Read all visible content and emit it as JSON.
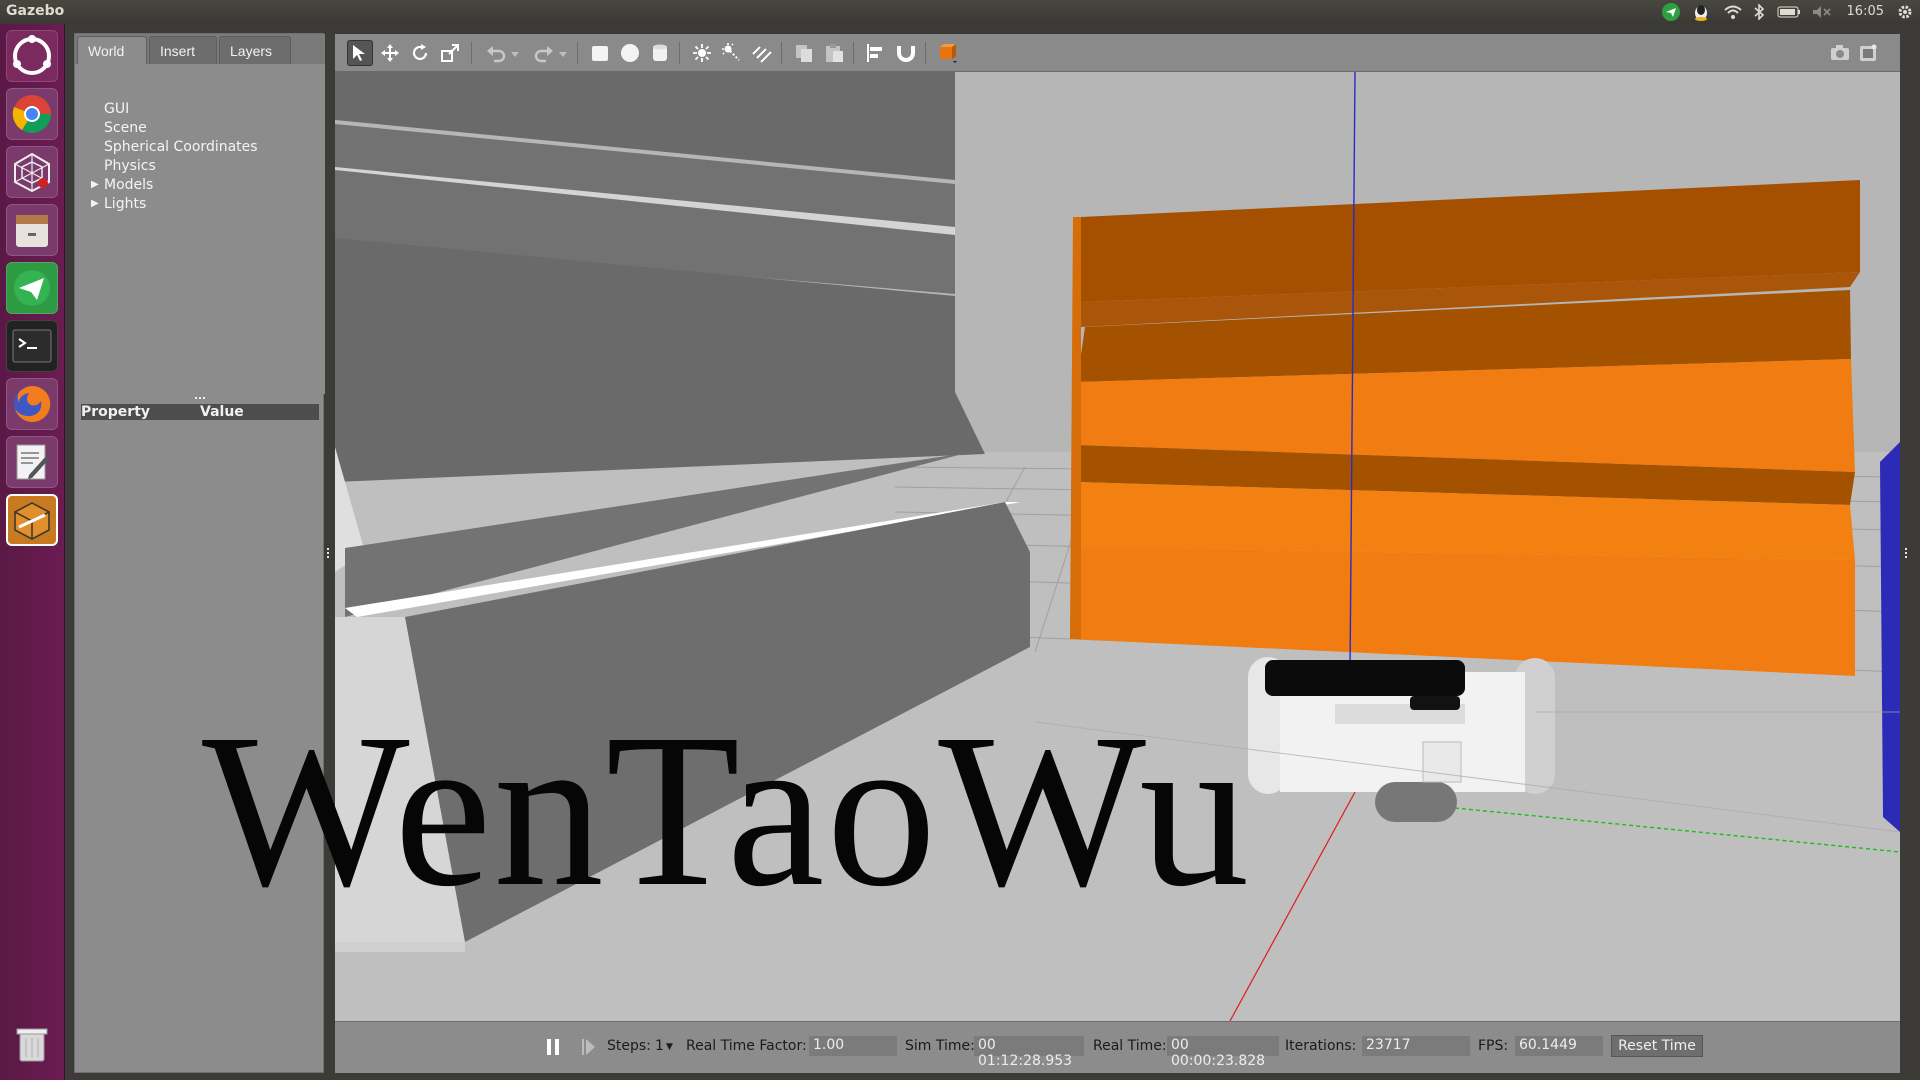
{
  "window": {
    "app_title": "Gazebo",
    "clock": "16:05"
  },
  "left_panel": {
    "tabs": [
      {
        "label": "World"
      },
      {
        "label": "Insert"
      },
      {
        "label": "Layers"
      }
    ],
    "tree_items": [
      {
        "label": "GUI"
      },
      {
        "label": "Scene"
      },
      {
        "label": "Spherical Coordinates"
      },
      {
        "label": "Physics"
      },
      {
        "label": "Models"
      },
      {
        "label": "Lights"
      }
    ],
    "property_header": "Property",
    "value_header": "Value"
  },
  "status": {
    "steps_label": "Steps:",
    "steps_value": "1",
    "rtf_label": "Real Time Factor:",
    "rtf_value": "1.00",
    "sim_time_label": "Sim Time:",
    "sim_time_value": "00 01:12:28.953",
    "real_time_label": "Real Time:",
    "real_time_value": "00 00:00:23.828",
    "iterations_label": "Iterations:",
    "iterations_value": "23717",
    "fps_label": "FPS:",
    "fps_value": "60.1449",
    "reset_label": "Reset Time"
  },
  "overlay": {
    "watermark": "WenTaoWu"
  },
  "colors": {
    "accent_orange": "#e07a10",
    "ground": "#b9b9b9",
    "launcher": "#6b1c52"
  }
}
